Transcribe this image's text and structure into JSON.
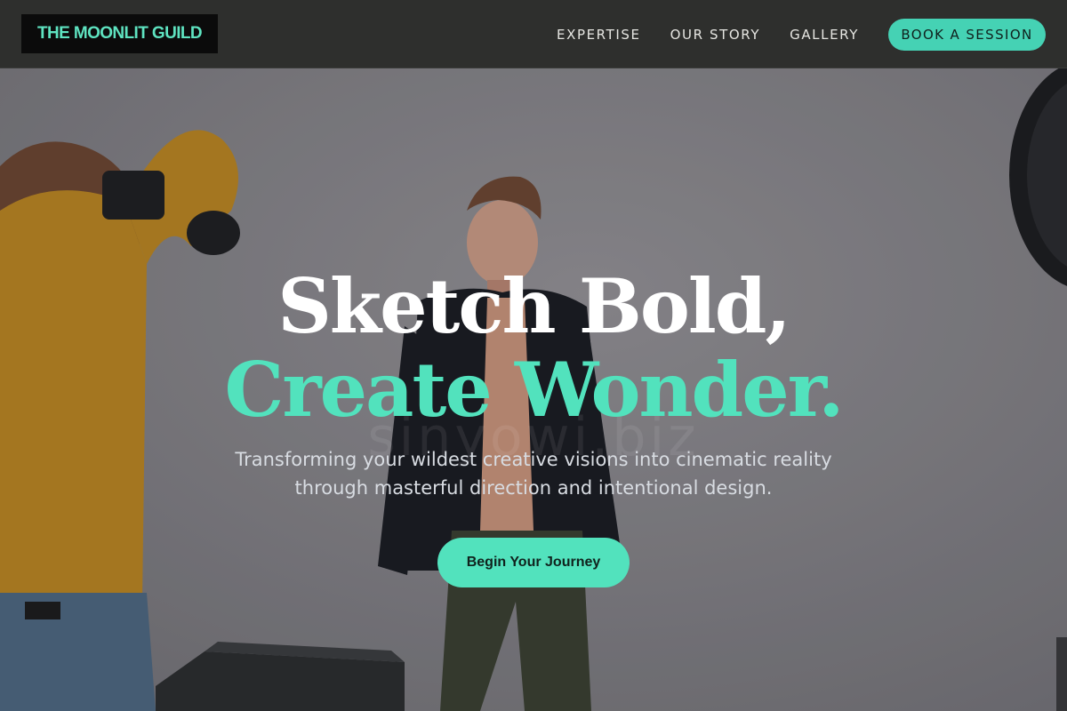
{
  "header": {
    "logo_text": "THE MOONLIT GUILD",
    "nav_links": [
      "EXPERTISE",
      "OUR STORY",
      "GALLERY"
    ],
    "book_label": "BOOK A SESSION"
  },
  "hero": {
    "headline_line1": "Sketch Bold,",
    "headline_line2": "Create Wonder.",
    "subheadline": "Transforming your wildest creative visions into cinematic reality through masterful direction and intentional design.",
    "cta_label": "Begin Your Journey",
    "watermark": "sinyowi.biz"
  },
  "colors": {
    "accent": "#52e2bd",
    "header_bg": "#2e2f2d",
    "logo_bg": "#0b0b0b",
    "headline_white": "#ffffff"
  }
}
